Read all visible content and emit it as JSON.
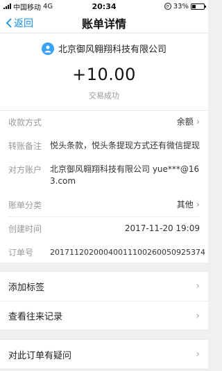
{
  "status_bar": {
    "carrier": "中国移动",
    "network": "4G",
    "time": "20:34",
    "battery": "33%"
  },
  "nav": {
    "back_label": "返回",
    "title": "账单详情"
  },
  "summary": {
    "merchant": "北京御风翱翔科技有限公司",
    "amount": "+10.00",
    "status": "交易成功"
  },
  "details": {
    "payment_method": {
      "label": "收款方式",
      "value": "余额"
    },
    "transfer_note": {
      "label": "转账备注",
      "value": "悦头条款，悦头条提现方式还有微信提现"
    },
    "counterparty": {
      "label": "对方账户",
      "value": "北京御风翱翔科技有限公司 yue***@163.com"
    },
    "category": {
      "label": "账单分类",
      "value": "其他"
    },
    "created_time": {
      "label": "创建时间",
      "value": "2017-11-20 19:09"
    },
    "order_no": {
      "label": "订单号",
      "value": "20171120200040011100260050925374"
    }
  },
  "actions": {
    "add_tag": "添加标签",
    "view_history": "查看往来记录",
    "question": "对此订单有疑问"
  },
  "colors": {
    "accent": "#108ee9",
    "avatar": "#37a2f8"
  }
}
